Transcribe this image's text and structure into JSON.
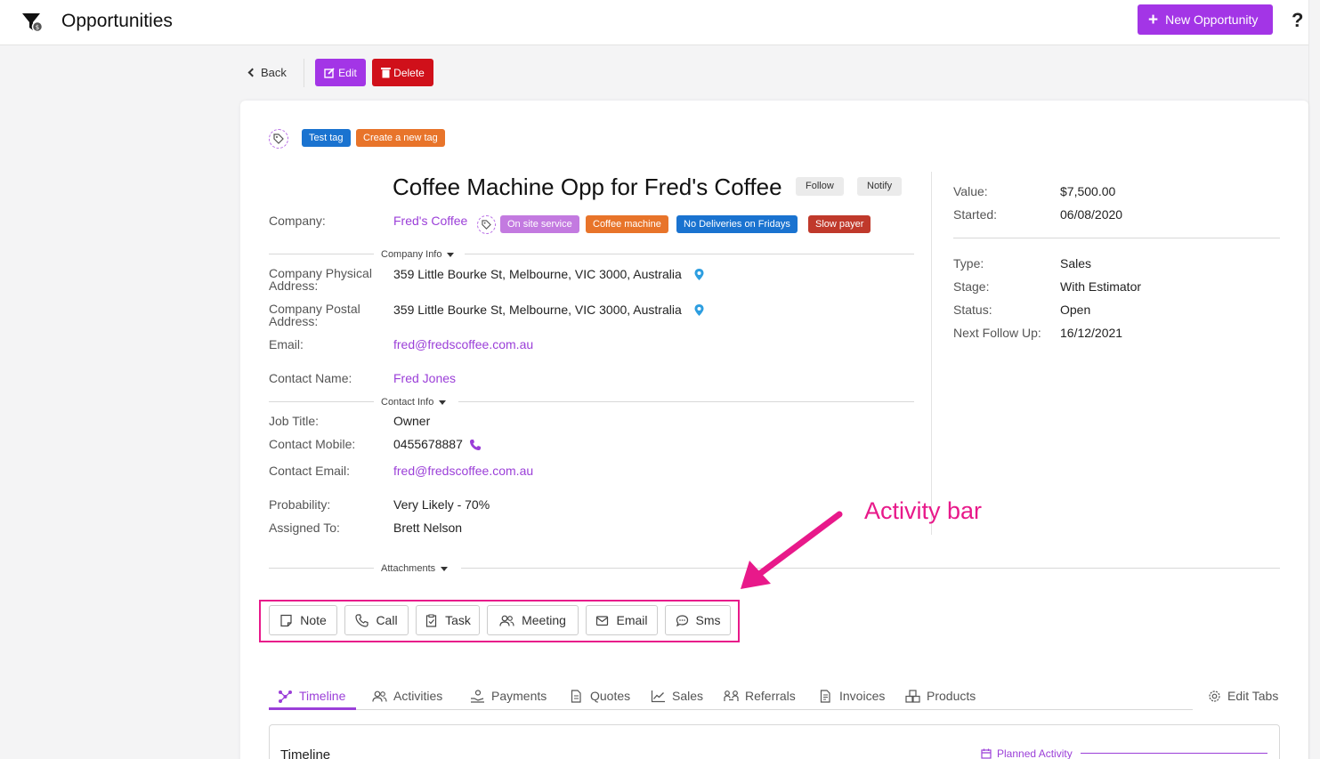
{
  "header": {
    "title": "Opportunities",
    "new_button": "New Opportunity",
    "help": "?"
  },
  "actions": {
    "back": "Back",
    "edit": "Edit",
    "delete": "Delete"
  },
  "tags": [
    "Test tag",
    "Create a new tag"
  ],
  "opportunity": {
    "title": "Coffee Machine Opp for Fred's Coffee",
    "follow": "Follow",
    "notify": "Notify",
    "company_label": "Company:",
    "company": "Fred's Coffee",
    "company_tags": [
      "On site service",
      "Coffee machine",
      "No Deliveries on Fridays",
      "Slow payer"
    ]
  },
  "company_info": {
    "section": "Company Info",
    "physical_label": "Company Physical Address:",
    "physical": "359 Little Bourke St, Melbourne, VIC 3000, Australia",
    "postal_label": "Company Postal Address:",
    "postal": "359 Little Bourke St, Melbourne, VIC 3000, Australia",
    "email_label": "Email:",
    "email": "fred@fredscoffee.com.au",
    "contact_name_label": "Contact Name:",
    "contact_name": "Fred Jones"
  },
  "contact_info": {
    "section": "Contact Info",
    "job_title_label": "Job Title:",
    "job_title": "Owner",
    "mobile_label": "Contact Mobile:",
    "mobile": "0455678887",
    "email_label": "Contact Email:",
    "email": "fred@fredscoffee.com.au",
    "probability_label": "Probability:",
    "probability": "Very Likely - 70%",
    "assigned_label": "Assigned To:",
    "assigned": "Brett Nelson"
  },
  "summary": {
    "value_label": "Value:",
    "value": "$7,500.00",
    "started_label": "Started:",
    "started": "06/08/2020",
    "type_label": "Type:",
    "type": "Sales",
    "stage_label": "Stage:",
    "stage": "With Estimator",
    "status_label": "Status:",
    "status": "Open",
    "followup_label": "Next Follow Up:",
    "followup": "16/12/2021"
  },
  "attachments": {
    "section": "Attachments"
  },
  "annotation": "Activity bar",
  "activity_bar": [
    "Note",
    "Call",
    "Task",
    "Meeting",
    "Email",
    "Sms"
  ],
  "tabs": [
    "Timeline",
    "Activities",
    "Payments",
    "Quotes",
    "Sales",
    "Referrals",
    "Invoices",
    "Products"
  ],
  "edit_tabs": "Edit Tabs",
  "timeline": {
    "title": "Timeline",
    "planned": "Planned Activity"
  },
  "colors": {
    "accent": "#a335e6",
    "delete": "#d0101a",
    "tag_blue": "#1a73d0",
    "tag_orange": "#e8742a",
    "tag_purple": "#c37ae0",
    "tag_red": "#c0392b",
    "annotation": "#e8198a"
  }
}
